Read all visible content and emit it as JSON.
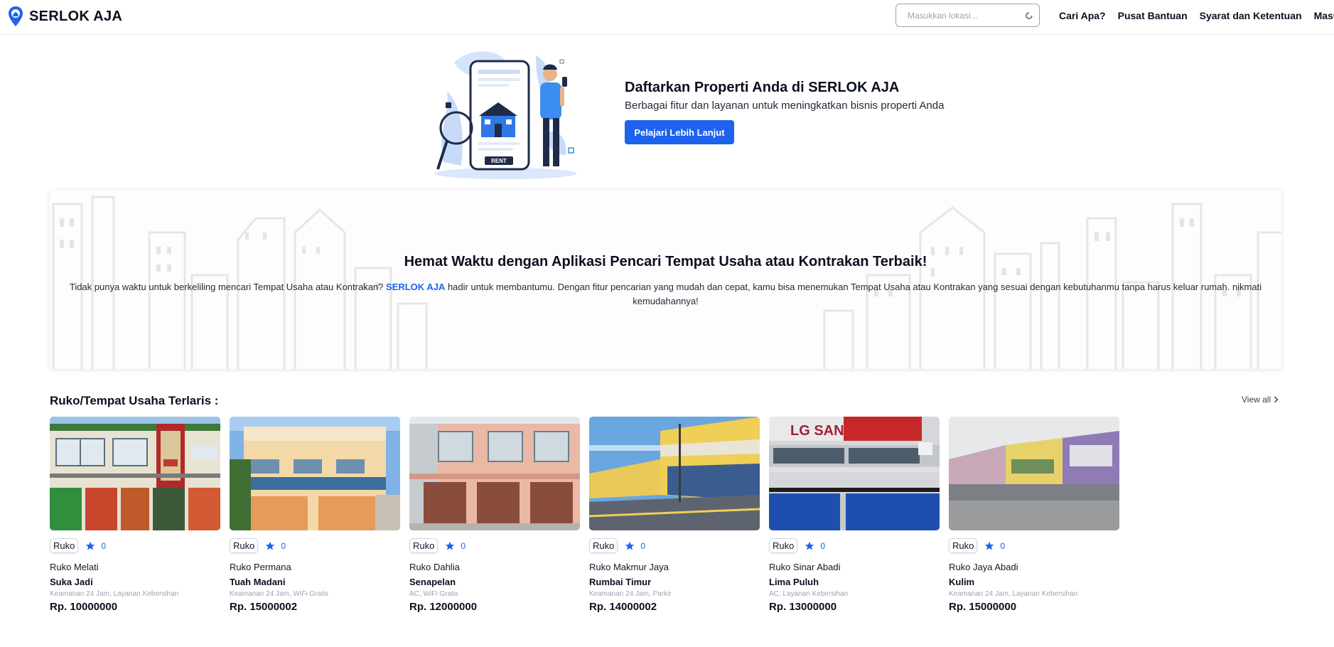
{
  "brand": {
    "name": "SERLOK AJA"
  },
  "search": {
    "placeholder": "Masukkan lokasi..."
  },
  "nav": {
    "items": [
      "Cari Apa?",
      "Pusat Bantuan",
      "Syarat dan Ketentuan",
      "Masuk"
    ]
  },
  "promo": {
    "title": "Daftarkan Properti Anda di SERLOK AJA",
    "subtitle": "Berbagai fitur dan layanan untuk meningkatkan bisnis properti Anda",
    "button": "Pelajari Lebih Lanjut",
    "sign_text": "RENT"
  },
  "hero": {
    "title": "Hemat Waktu dengan Aplikasi Pencari Tempat Usaha atau Kontrakan Terbaik!",
    "desc_before": "Tidak punya waktu untuk berkeliling mencari Tempat Usaha atau Kontrakan? ",
    "desc_accent": "SERLOK AJA",
    "desc_after": " hadir untuk membantumu. Dengan fitur pencarian yang mudah dan cepat, kamu bisa menemukan Tempat Usaha atau Kontrakan yang sesuai dengan kebutuhanmu tanpa harus keluar rumah. nikmati kemudahannya!"
  },
  "section": {
    "title": "Ruko/Tempat Usaha Terlaris :",
    "view_all": "View all"
  },
  "colors": {
    "accent": "#1d63ed",
    "text": "#0b1020",
    "muted": "#9ca3af"
  },
  "listings": [
    {
      "type": "Ruko",
      "rating": "0",
      "name": "Ruko Melati",
      "location": "Suka Jadi",
      "facilities": "Keamanan 24 Jam, Layanan Kebersihan",
      "price": "Rp. 10000000",
      "sign": ""
    },
    {
      "type": "Ruko",
      "rating": "0",
      "name": "Ruko Permana",
      "location": "Tuah Madani",
      "facilities": "Keamanan 24 Jam, WiFi Gratis",
      "price": "Rp. 15000002",
      "sign": ""
    },
    {
      "type": "Ruko",
      "rating": "0",
      "name": "Ruko Dahlia",
      "location": "Senapelan",
      "facilities": "AC, WiFi Gratis",
      "price": "Rp. 12000000",
      "sign": ""
    },
    {
      "type": "Ruko",
      "rating": "0",
      "name": "Ruko Makmur Jaya",
      "location": "Rumbai Timur",
      "facilities": "Keamanan 24 Jam, Parkir",
      "price": "Rp. 14000002",
      "sign": ""
    },
    {
      "type": "Ruko",
      "rating": "0",
      "name": "Ruko Sinar Abadi",
      "location": "Lima Puluh",
      "facilities": "AC, Layanan Kebersihan",
      "price": "Rp. 13000000",
      "sign": "LG  SANKEN"
    },
    {
      "type": "Ruko",
      "rating": "0",
      "name": "Ruko Jaya Abadi",
      "location": "Kulim",
      "facilities": "Keamanan 24 Jam, Layanan Kebersihan",
      "price": "Rp. 15000000",
      "sign": ""
    }
  ]
}
